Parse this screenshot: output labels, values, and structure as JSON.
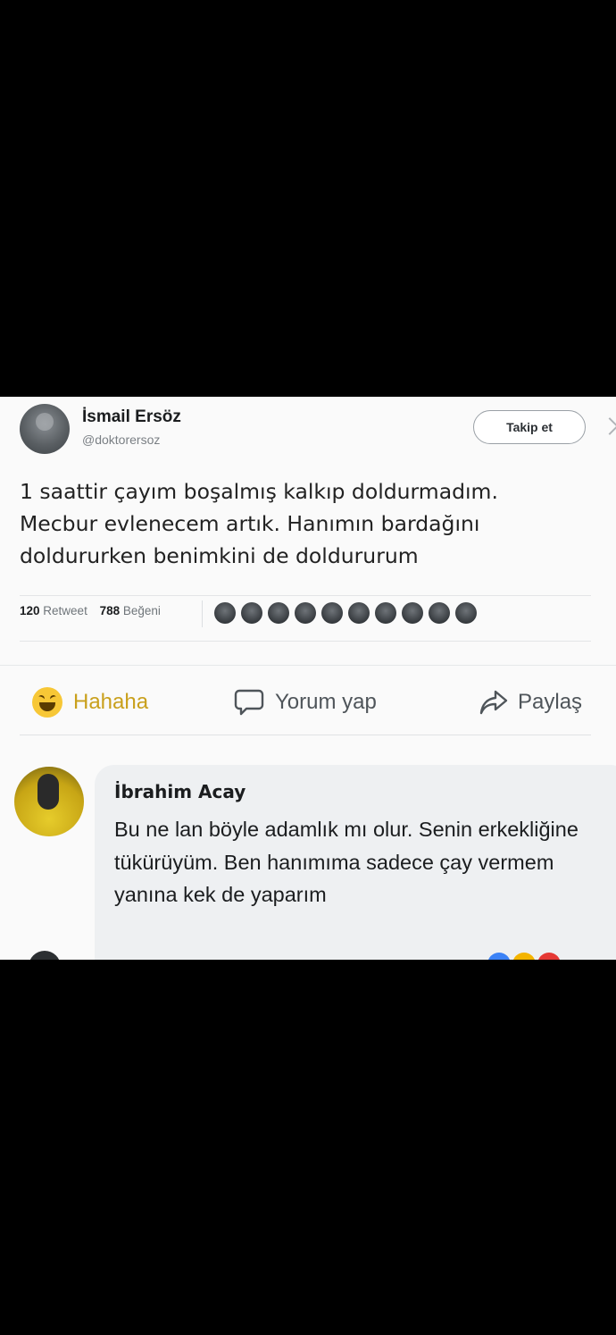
{
  "tweet": {
    "author_name": "İsmail Ersöz",
    "author_handle": "@doktorersoz",
    "follow_label": "Takip et",
    "text": "1 saattir çayım boşalmış kalkıp doldurmadım.\nMecbur evlenecem artık. Hanımın bardağını\ndoldururken benimkini de doldururum",
    "retweet_count": "120",
    "retweet_label": "Retweet",
    "like_count": "788",
    "like_label": "Beğeni"
  },
  "actions": {
    "haha_label": "Hahaha",
    "comment_label": "Yorum yap",
    "share_label": "Paylaş"
  },
  "comment": {
    "author_name": "İbrahim Acay",
    "text": "Bu ne lan böyle adamlık mı olur. Senin erkekliğine tükürüyüm. Ben hanımıma sadece çay vermem yanına kek de yaparım"
  },
  "colors": {
    "haha_accent": "#c9a01c",
    "background": "#000000",
    "card": "#fafafa",
    "bubble": "#eef0f2"
  }
}
